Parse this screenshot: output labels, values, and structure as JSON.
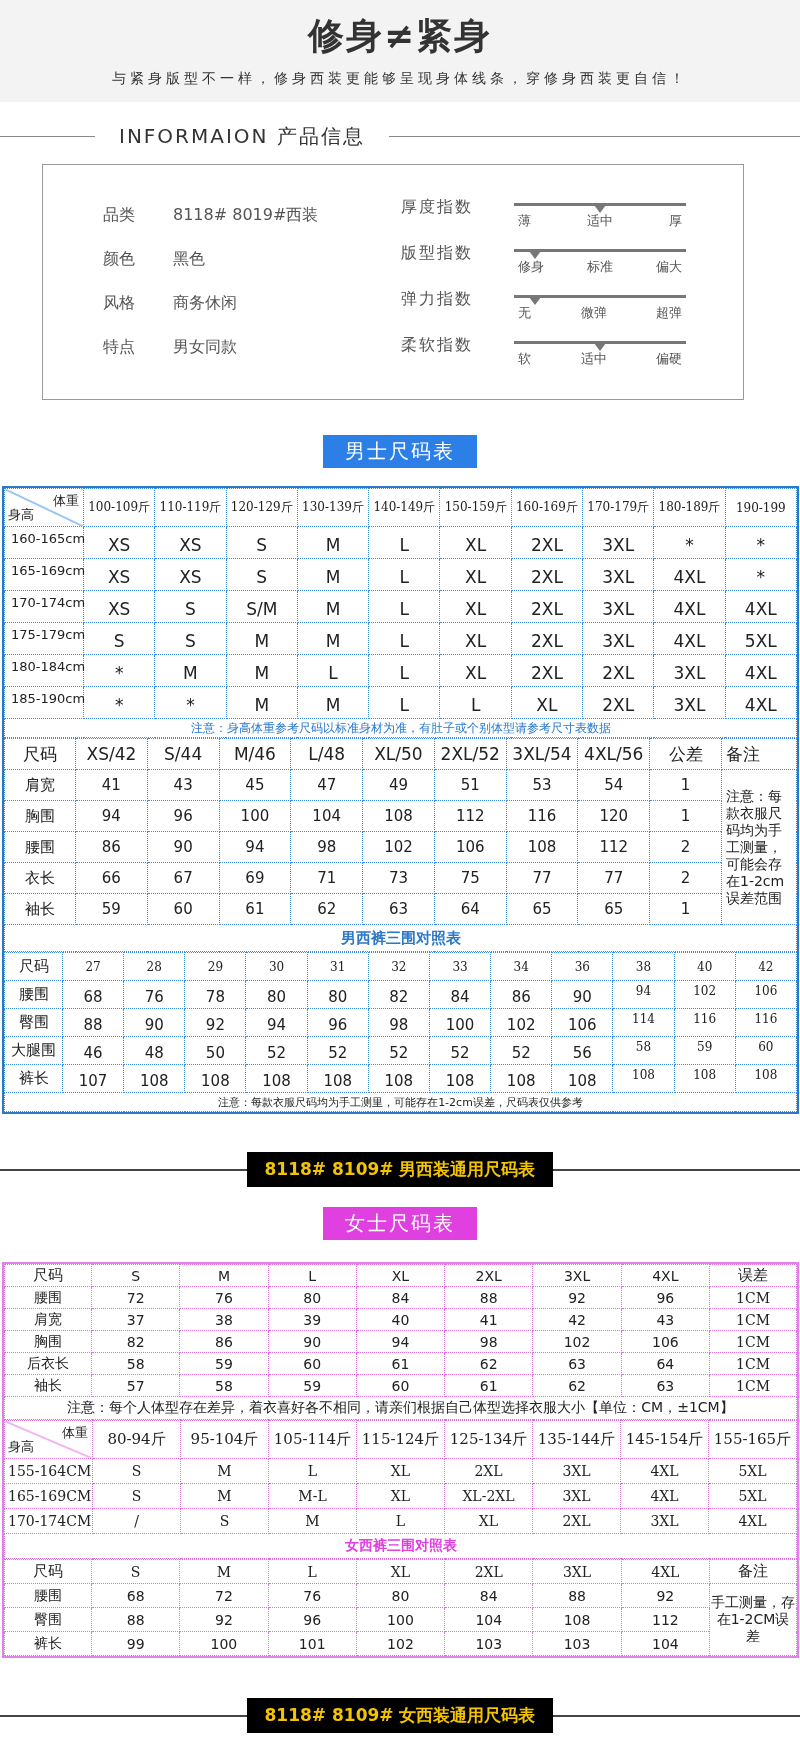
{
  "header": {
    "title": "修身≠紧身",
    "subtitle": "与紧身版型不一样，修身西装更能够呈现身体线条，穿修身西装更自信！"
  },
  "info": {
    "heading": "INFORMAION 产品信息",
    "attributes": [
      {
        "label": "品类",
        "value": "8118# 8019#西装"
      },
      {
        "label": "颜色",
        "value": "黑色"
      },
      {
        "label": "风格",
        "value": "商务休闲"
      },
      {
        "label": "特点",
        "value": "男女同款"
      }
    ],
    "indices": [
      {
        "label": "厚度指数",
        "level": 0.5,
        "options": [
          "薄",
          "适中",
          "厚"
        ]
      },
      {
        "label": "版型指数",
        "level": 0.12,
        "options": [
          "修身",
          "标准",
          "偏大"
        ]
      },
      {
        "label": "弹力指数",
        "level": 0.12,
        "options": [
          "无",
          "微弹",
          "超弹"
        ]
      },
      {
        "label": "柔软指数",
        "level": 0.5,
        "options": [
          "软",
          "适中",
          "偏硬"
        ]
      }
    ]
  },
  "men": {
    "button": "男士尺码表",
    "matrix": {
      "corner_top": "体重",
      "corner_bottom": "身高",
      "columns": [
        "100-109斤",
        "110-119斤",
        "120-129斤",
        "130-139斤",
        "140-149斤",
        "150-159斤",
        "160-169斤",
        "170-179斤",
        "180-189斤",
        "190-199"
      ],
      "rows": [
        {
          "label": "160-165cm",
          "cells": [
            "XS",
            "XS",
            "S",
            "M",
            "L",
            "XL",
            "2XL",
            "3XL",
            "*",
            "*"
          ]
        },
        {
          "label": "165-169cm",
          "cells": [
            "XS",
            "XS",
            "S",
            "M",
            "L",
            "XL",
            "2XL",
            "3XL",
            "4XL",
            "*"
          ]
        },
        {
          "label": "170-174cm",
          "cells": [
            "XS",
            "S",
            "S/M",
            "M",
            "L",
            "XL",
            "2XL",
            "3XL",
            "4XL",
            "4XL"
          ]
        },
        {
          "label": "175-179cm",
          "cells": [
            "S",
            "S",
            "M",
            "M",
            "L",
            "XL",
            "2XL",
            "3XL",
            "4XL",
            "5XL"
          ]
        },
        {
          "label": "180-184cm",
          "cells": [
            "*",
            "M",
            "M",
            "L",
            "L",
            "XL",
            "2XL",
            "2XL",
            "3XL",
            "4XL"
          ]
        },
        {
          "label": "185-190cm",
          "cells": [
            "*",
            "*",
            "M",
            "M",
            "L",
            "L",
            "XL",
            "2XL",
            "3XL",
            "4XL"
          ]
        }
      ]
    },
    "matrix_note": "注意：身高体重参考尺码以标准身材为准，有肚子或个别体型请参考尺寸表数据",
    "sizes": {
      "corner": "尺码",
      "columns": [
        "XS/42",
        "S/44",
        "M/46",
        "L/48",
        "XL/50",
        "2XL/52",
        "3XL/54",
        "4XL/56",
        "公差",
        "备注"
      ],
      "rows": [
        {
          "label": "肩宽",
          "cells": [
            "41",
            "43",
            "45",
            "47",
            "49",
            "51",
            "53",
            "54",
            "1"
          ]
        },
        {
          "label": "胸围",
          "cells": [
            "94",
            "96",
            "100",
            "104",
            "108",
            "112",
            "116",
            "120",
            "1"
          ]
        },
        {
          "label": "腰围",
          "cells": [
            "86",
            "90",
            "94",
            "98",
            "102",
            "106",
            "108",
            "112",
            "2"
          ]
        },
        {
          "label": "衣长",
          "cells": [
            "66",
            "67",
            "69",
            "71",
            "73",
            "75",
            "77",
            "77",
            "2"
          ]
        },
        {
          "label": "袖长",
          "cells": [
            "59",
            "60",
            "61",
            "62",
            "63",
            "64",
            "65",
            "65",
            "1"
          ]
        }
      ],
      "remark": "注意：每款衣服尺码均为手工测量，可能会存在1-2cm误差范围"
    },
    "pants_title": "男西裤三围对照表",
    "pants": {
      "corner": "尺码",
      "columns": [
        "27",
        "28",
        "29",
        "30",
        "31",
        "32",
        "33",
        "34",
        "36",
        "38",
        "40",
        "42"
      ],
      "rows": [
        {
          "label": "腰围",
          "cells": [
            "68",
            "76",
            "78",
            "80",
            "80",
            "82",
            "84",
            "86",
            "90",
            "94",
            "102",
            "106"
          ]
        },
        {
          "label": "臀围",
          "cells": [
            "88",
            "90",
            "92",
            "94",
            "96",
            "98",
            "100",
            "102",
            "106",
            "114",
            "116",
            "116"
          ]
        },
        {
          "label": "大腿围",
          "cells": [
            "46",
            "48",
            "50",
            "52",
            "52",
            "52",
            "52",
            "52",
            "56",
            "58",
            "59",
            "60"
          ]
        },
        {
          "label": "裤长",
          "cells": [
            "107",
            "108",
            "108",
            "108",
            "108",
            "108",
            "108",
            "108",
            "108",
            "108",
            "108",
            "108"
          ]
        }
      ]
    },
    "pants_note": "注意：每款衣服尺码均为手工测里，可能存在1-2cm误差，尺码表仅供参考"
  },
  "men_banner": "8118# 8109#  男西装通用尺码表",
  "women": {
    "button": "女士尺码表",
    "sizes": {
      "corner": "尺码",
      "columns": [
        "S",
        "M",
        "L",
        "XL",
        "2XL",
        "3XL",
        "4XL",
        "误差"
      ],
      "rows": [
        {
          "label": "腰围",
          "cells": [
            "72",
            "76",
            "80",
            "84",
            "88",
            "92",
            "96",
            "1CM"
          ]
        },
        {
          "label": "肩宽",
          "cells": [
            "37",
            "38",
            "39",
            "40",
            "41",
            "42",
            "43",
            "1CM"
          ]
        },
        {
          "label": "胸围",
          "cells": [
            "82",
            "86",
            "90",
            "94",
            "98",
            "102",
            "106",
            "1CM"
          ]
        },
        {
          "label": "后衣长",
          "cells": [
            "58",
            "59",
            "60",
            "61",
            "62",
            "63",
            "64",
            "1CM"
          ]
        },
        {
          "label": "袖长",
          "cells": [
            "57",
            "58",
            "59",
            "60",
            "61",
            "62",
            "63",
            "1CM"
          ]
        }
      ]
    },
    "sizes_note": "注意：每个人体型存在差异，着衣喜好各不相同，请亲们根据自己体型选择衣服大小【单位：CM，±1CM】",
    "matrix": {
      "corner_top": "体重",
      "corner_bottom": "身高",
      "columns": [
        "80-94斤",
        "95-104斤",
        "105-114斤",
        "115-124斤",
        "125-134斤",
        "135-144斤",
        "145-154斤",
        "155-165斤"
      ],
      "rows": [
        {
          "label": "155-164CM",
          "cells": [
            "S",
            "M",
            "L",
            "XL",
            "2XL",
            "3XL",
            "4XL",
            "5XL"
          ]
        },
        {
          "label": "165-169CM",
          "cells": [
            "S",
            "M",
            "M-L",
            "XL",
            "XL-2XL",
            "3XL",
            "4XL",
            "5XL"
          ]
        },
        {
          "label": "170-174CM",
          "cells": [
            "/",
            "S",
            "M",
            "L",
            "XL",
            "2XL",
            "3XL",
            "4XL"
          ]
        }
      ]
    },
    "pants_title": "女西裤三围对照表",
    "pants": {
      "corner": "尺码",
      "columns": [
        "S",
        "M",
        "L",
        "XL",
        "2XL",
        "3XL",
        "4XL",
        "备注"
      ],
      "rows": [
        {
          "label": "腰围",
          "cells": [
            "68",
            "72",
            "76",
            "80",
            "84",
            "88",
            "92"
          ]
        },
        {
          "label": "臀围",
          "cells": [
            "88",
            "92",
            "96",
            "100",
            "104",
            "108",
            "112"
          ]
        },
        {
          "label": "裤长",
          "cells": [
            "99",
            "100",
            "101",
            "102",
            "103",
            "103",
            "104"
          ]
        }
      ],
      "remark": "手工测量，存在1-2CM误差"
    }
  },
  "women_banner": "8118# 8109# 女西装通用尺码表"
}
